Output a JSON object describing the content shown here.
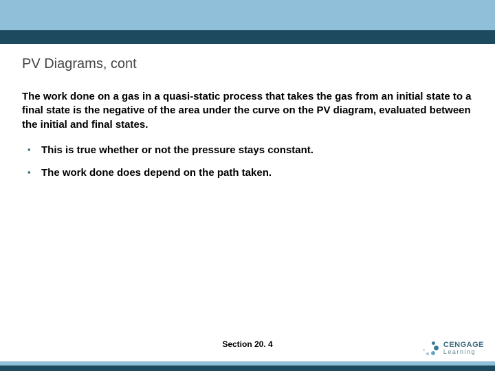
{
  "title": "PV Diagrams, cont",
  "paragraph": "The work done on a gas in a quasi-static process that takes the gas from an initial state to a final state is the negative of the area under the curve on the PV diagram, evaluated between the initial and final states.",
  "bullets": [
    "This is true whether or not the pressure stays constant.",
    "The work done does depend on the path taken."
  ],
  "section_label": "Section  20. 4",
  "logo": {
    "brand": "CENGAGE",
    "sub": "Learning"
  }
}
